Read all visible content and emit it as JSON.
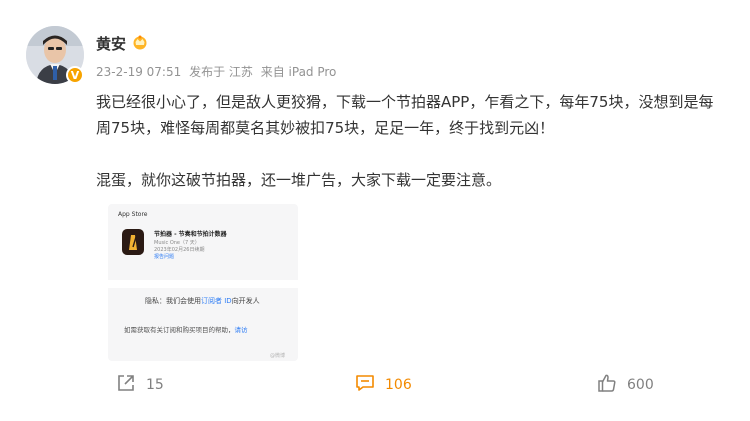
{
  "post": {
    "author": {
      "name": "黄安",
      "verified_badge": "V",
      "crown_icon": "crown-badge-icon",
      "avatar_icon": "profile-avatar"
    },
    "meta": {
      "time": "23-2-19 07:51",
      "location": "发布于 江苏",
      "source": "来自 iPad Pro"
    },
    "text": {
      "paragraph1": "我已经很小心了，但是敌人更狡猾，下载一个节拍器APP，乍看之下，每年75块，没想到是每周75块，难怪每周都莫名其妙被扣75块，足足一年，终于找到元凶！",
      "paragraph2": "混蛋，就你这破节拍器，还一堆广告，大家下载一定要注意。"
    },
    "image": {
      "store_label": "App Store",
      "app_title": "节拍器 - 节奏和节拍计数器",
      "app_sub": "Music One（7 天）",
      "app_date": "2023年02月26日续期",
      "app_report": "报告问题",
      "privacy_prefix": "隐私：我们会使用",
      "privacy_link": "订阅者 ID",
      "privacy_suffix": "向开发人",
      "help_text": "如需获取有关订阅和购买项目的帮助，",
      "help_link": "请访",
      "watermark": "@微博"
    },
    "actions": {
      "share_count": "15",
      "comment_count": "106",
      "like_count": "600"
    },
    "colors": {
      "accent_orange": "#f38a00",
      "verified": "#f7a300",
      "link_blue": "#2f7df5"
    }
  }
}
